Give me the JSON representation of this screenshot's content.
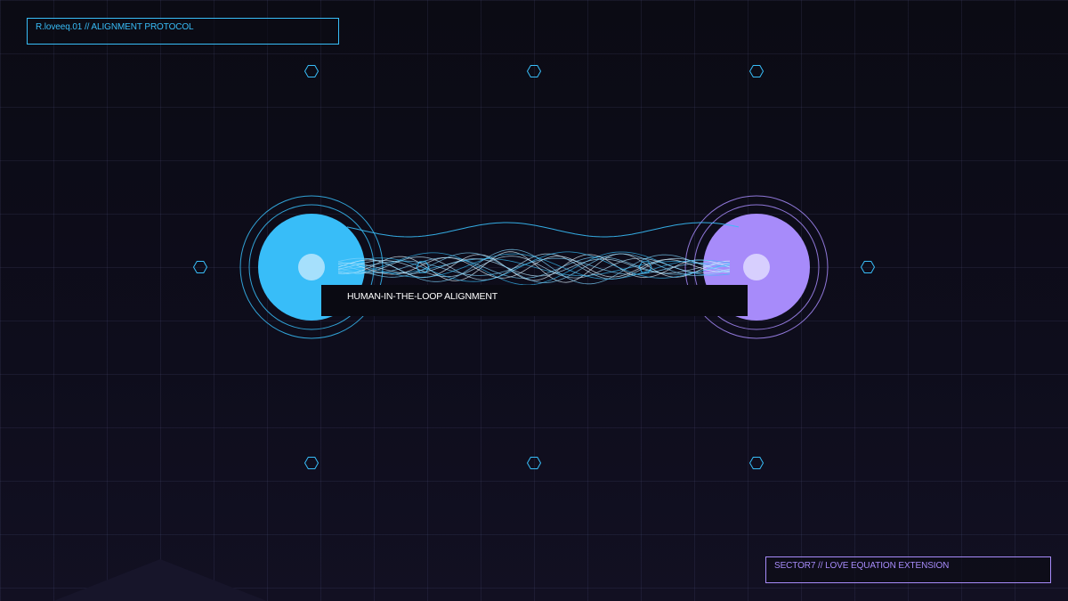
{
  "header_tag": {
    "text": "R.loveeq.01 // ALIGNMENT PROTOCOL"
  },
  "banner": {
    "text": "HUMAN-IN-THE-LOOP ALIGNMENT"
  },
  "footer_tag": {
    "text": "SECTOR7 // LOVE EQUATION EXTENSION"
  },
  "colors": {
    "background": "#0b0b14",
    "grid": "#2a2a44",
    "human_node": "#38bdf8",
    "machine_node": "#a78bfa",
    "wave_cyan": "#38bdf8",
    "wave_light": "#bae6fd",
    "banner_background": "#0a0a12"
  },
  "icons": [
    "hexagon-marker-icon",
    "concentric-ring-icon"
  ]
}
